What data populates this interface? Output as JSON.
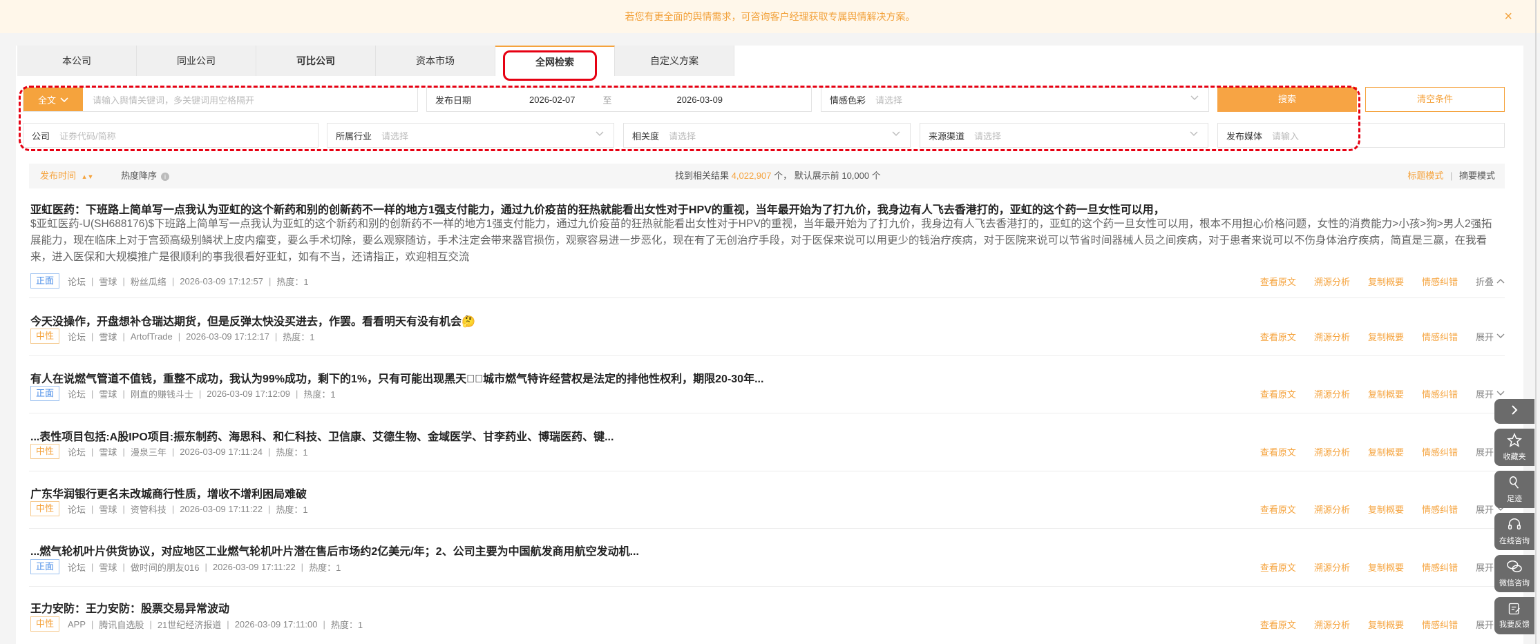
{
  "banner": {
    "text": "若您有更全面的舆情需求，可咨询客户经理获取专属舆情解决方案。",
    "close": "×"
  },
  "tabs": [
    "本公司",
    "同业公司",
    "可比公司",
    "资本市场",
    "全网检索",
    "自定义方案"
  ],
  "active_tab": "全网检索",
  "filters": {
    "scope": "全文",
    "keyword_placeholder": "请输入舆情关键词，多关键词用空格隔开",
    "date_label": "发布日期",
    "date_from": "2026-02-07",
    "date_to_sep": "至",
    "date_to": "2026-03-09",
    "sentiment_label": "情感色彩",
    "sentiment_placeholder": "请选择",
    "search": "搜索",
    "clear": "清空条件",
    "company_label": "公司",
    "company_placeholder": "证券代码/简称",
    "industry_label": "所属行业",
    "industry_placeholder": "请选择",
    "relevance_label": "相关度",
    "relevance_placeholder": "请选择",
    "source_label": "来源渠道",
    "source_placeholder": "请选择",
    "media_label": "发布媒体",
    "media_placeholder": "请输入"
  },
  "sortbar": {
    "sort_time": "发布时间",
    "sort_heat": "热度降序",
    "result_prefix": "找到相关结果",
    "result_count": "4,022,907",
    "result_suffix": "个， 默认展示前 10,000 个",
    "mode_title": "标题模式",
    "mode_sep": "|",
    "mode_summary": "摘要模式"
  },
  "actions": {
    "view": "查看原文",
    "trace": "溯源分析",
    "copy": "复制概要",
    "correct": "情感纠错"
  },
  "items": [
    {
      "title": "亚虹医药：下班路上简单写一点我认为亚虹的这个新药和别的创新药不一样的地方1强支付能力，通过九价疫苗的狂热就能看出女性对于HPV的重视，当年最开始为了打九价，我身边有人飞去香港打的，亚虹的这个药一旦女性可以用，",
      "body": "$亚虹医药-U(SH688176)$下班路上简单写一点我认为亚虹的这个新药和别的创新药不一样的地方1强支付能力，通过九价疫苗的狂热就能看出女性对于HPV的重视，当年最开始为了打九价，我身边有人飞去香港打的，亚虹的这个药一旦女性可以用，根本不用担心价格问题，女性的消费能力>小孩>狗>男人2强拓展能力，现在临床上对于宫颈高级别鳞状上皮内瘤变，要么手术切除，要么观察随访，手术注定会带来器官损伤，观察容易进一步恶化，现在有了无创治疗手段，对于医保来说可以用更少的钱治疗疾病，对于医院来说可以节省时间器械人员之间疾病，对于患者来说可以不伤身体治疗疾病，简直是三赢，在我看来，进入医保和大规模推广是很顺利的事我很看好亚虹，如有不当，还请指正，欢迎相互交流",
      "sentiment": "正面",
      "channel": "论坛",
      "site": "雪球",
      "author": "粉丝瓜络",
      "time": "2026-03-09 17:12:57",
      "heat": "热度：1",
      "fold": "折叠"
    },
    {
      "title": "今天没操作，开盘想补仓瑞达期货，但是反弹太快没买进去，作罢。看看明天有没有机会🤔",
      "sentiment": "中性",
      "channel": "论坛",
      "site": "雪球",
      "author": "ArtofTrade",
      "time": "2026-03-09 17:12:17",
      "heat": "热度：1",
      "fold": "展开"
    },
    {
      "title": "有人在说燃气管道不值钱，重整不成功，我认为99%成功，剩下的1%，只有可能出现黑天鹅⃣城市燃气特许经营权是法定的排他性权利，期限20-30年...",
      "sentiment": "正面",
      "channel": "论坛",
      "site": "雪球",
      "author": "刚直的赚钱斗士",
      "time": "2026-03-09 17:12:09",
      "heat": "热度：1",
      "fold": "展开"
    },
    {
      "title": "...表性项目包括:A股IPO项目:振东制药、海思科、和仁科技、卫信康、艾德生物、金域医学、甘李药业、博瑞医药、键...",
      "sentiment": "中性",
      "channel": "论坛",
      "site": "雪球",
      "author": "漫泉三年",
      "time": "2026-03-09 17:11:24",
      "heat": "热度：1",
      "fold": "展开"
    },
    {
      "title": "广东华润银行更名未改城商行性质，增收不增利困局难破",
      "sentiment": "中性",
      "channel": "论坛",
      "site": "雪球",
      "author": "资管科技",
      "time": "2026-03-09 17:11:22",
      "heat": "热度：1",
      "fold": "展开"
    },
    {
      "title": "...燃气轮机叶片供货协议，对应地区工业燃气轮机叶片潜在售后市场约2亿美元/年；2、公司主要为中国航发商用航空发动机...",
      "sentiment": "正面",
      "channel": "论坛",
      "site": "雪球",
      "author": "做时间的朋友016",
      "time": "2026-03-09 17:11:22",
      "heat": "热度：1",
      "fold": "展开"
    },
    {
      "title": "王力安防：王力安防：股票交易异常波动",
      "sentiment": "中性",
      "channel": "APP",
      "site": "腾讯自选股",
      "author": "21世纪经济报道",
      "time": "2026-03-09 17:11:00",
      "heat": "热度：1",
      "fold": "展开"
    }
  ],
  "side_tools": [
    {
      "icon": "chevron-right-icon",
      "label": ""
    },
    {
      "icon": "star-icon",
      "label": "收藏夹"
    },
    {
      "icon": "footprint-icon",
      "label": "足迹"
    },
    {
      "icon": "headset-icon",
      "label": "在线咨询"
    },
    {
      "icon": "wechat-icon",
      "label": "微信咨询"
    },
    {
      "icon": "feedback-icon",
      "label": "我要反馈"
    }
  ],
  "colors": {
    "accent": "#f5a33d",
    "highlight": "#e60012",
    "positive": "#4a8ee8"
  }
}
